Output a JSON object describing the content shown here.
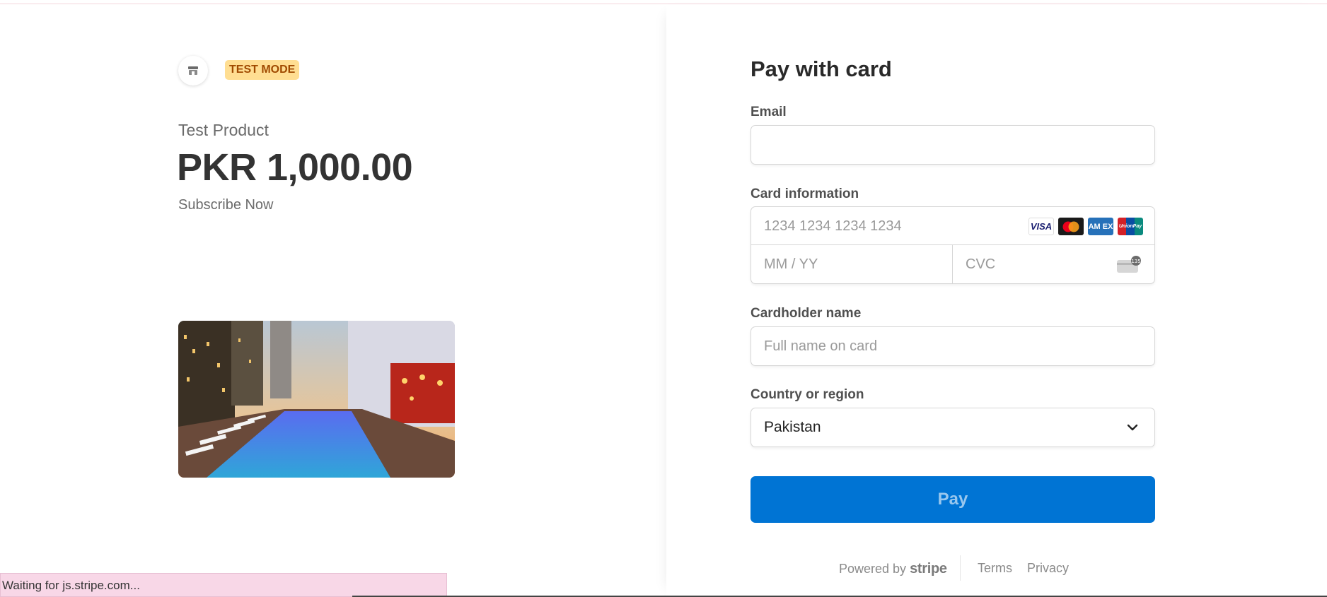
{
  "merchant": {
    "icon": "store-icon",
    "badge": "TEST MODE"
  },
  "product": {
    "name": "Test Product",
    "price": "PKR 1,000.00",
    "description": "Subscribe Now",
    "image": "hotel-pool-photo"
  },
  "form": {
    "title": "Pay with card",
    "email": {
      "label": "Email",
      "value": "",
      "placeholder": ""
    },
    "card": {
      "label": "Card information",
      "number_placeholder": "1234 1234 1234 1234",
      "expiry_placeholder": "MM / YY",
      "cvc_placeholder": "CVC",
      "brands": [
        "visa-icon",
        "mastercard-icon",
        "amex-icon",
        "unionpay-icon"
      ],
      "visa_text": "VISA",
      "amex_text": "AM EX",
      "unionpay_text": "UnionPay",
      "cvc_hint": "135"
    },
    "cardholder": {
      "label": "Cardholder name",
      "placeholder": "Full name on card"
    },
    "country": {
      "label": "Country or region",
      "value": "Pakistan"
    },
    "pay_button": "Pay"
  },
  "footer": {
    "powered_by": "Powered by",
    "brand": "stripe",
    "terms": "Terms",
    "privacy": "Privacy"
  },
  "status_bar": {
    "text": "Waiting for js.stripe.com..."
  },
  "colors": {
    "accent": "#0074d4",
    "test_badge_bg": "#ffde92",
    "test_badge_text": "#a04a00",
    "status_bar_bg": "#f8d7e7"
  }
}
